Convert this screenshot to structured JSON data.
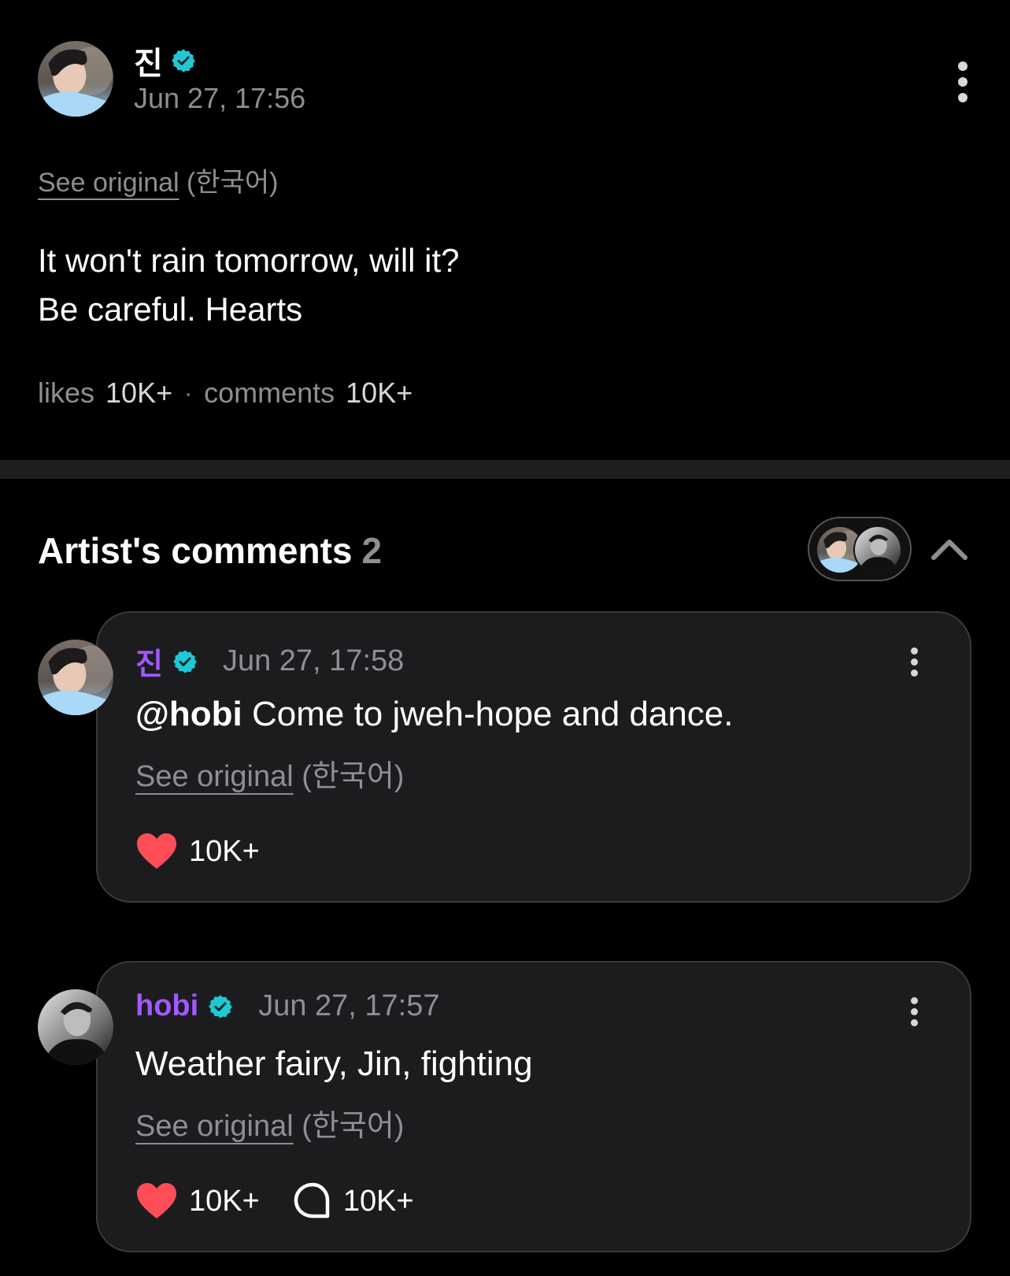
{
  "post": {
    "author": "진",
    "date": "Jun 27, 17:56",
    "see_original": "See original",
    "original_lang": "(한국어)",
    "body_line1": "It won't rain tomorrow, will it?",
    "body_line2": "Be careful. Hearts",
    "likes_label": "likes",
    "likes_count": "10K+",
    "separator": "·",
    "comments_label": "comments",
    "comments_count": "10K+"
  },
  "artist_comments": {
    "title": "Artist's comments",
    "count": "2"
  },
  "comments": [
    {
      "author": "진",
      "date": "Jun 27, 17:58",
      "mention": "@hobi",
      "text": " Come to jweh-hope and dance.",
      "see_original": "See original",
      "original_lang": "(한국어)",
      "likes": "10K+"
    },
    {
      "author": "hobi",
      "date": "Jun 27, 17:57",
      "text": "Weather fairy, Jin, fighting",
      "see_original": "See original",
      "original_lang": "(한국어)",
      "likes": "10K+",
      "replies": "10K+"
    }
  ],
  "colors": {
    "background": "#000000",
    "card": "#1c1c1e",
    "accent_name": "#a259ff",
    "verified": "#1fc9d4",
    "heart": "#ff4d57",
    "muted": "#8e8e93"
  },
  "icons": [
    "verified-badge-icon",
    "more-vertical-icon",
    "chevron-up-icon",
    "heart-icon",
    "comment-bubble-icon"
  ]
}
